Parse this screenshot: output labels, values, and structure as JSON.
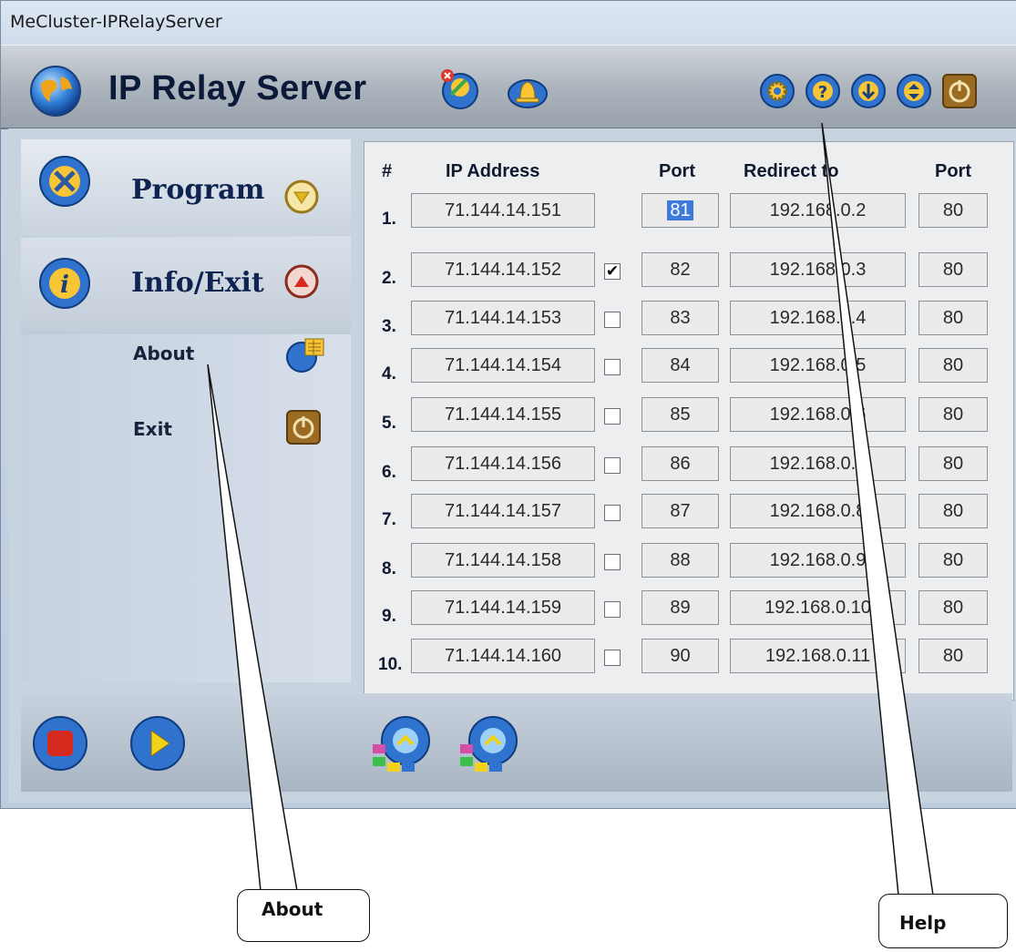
{
  "window": {
    "title": "MeCluster-IPRelayServer"
  },
  "app": {
    "title": "IP Relay Server"
  },
  "toolbar_icons": [
    "connect-icon",
    "bell-icon",
    "settings-gear-icon",
    "help-icon",
    "download-icon",
    "updown-icon",
    "power-icon"
  ],
  "sidebar": {
    "program": {
      "label": "Program",
      "icon": "tools-icon",
      "toggle_icon": "expand-down-icon"
    },
    "info": {
      "label": "Info/Exit",
      "icon": "info-icon",
      "toggle_icon": "collapse-up-icon"
    },
    "items": [
      {
        "label": "About",
        "icon": "about-icon"
      },
      {
        "label": "Exit",
        "icon": "exit-power-icon"
      }
    ]
  },
  "table": {
    "headers": {
      "num": "#",
      "ip": "IP Address",
      "port": "Port",
      "redirect": "Redirect to",
      "port2": "Port"
    },
    "rows": [
      {
        "num": "1.",
        "ip": "71.144.14.151",
        "checked": null,
        "port": "81",
        "redirect": "192.168.0.2",
        "rport": "80"
      },
      {
        "num": "2.",
        "ip": "71.144.14.152",
        "checked": true,
        "port": "82",
        "redirect": "192.168.0.3",
        "rport": "80"
      },
      {
        "num": "3.",
        "ip": "71.144.14.153",
        "checked": false,
        "port": "83",
        "redirect": "192.168.0.4",
        "rport": "80"
      },
      {
        "num": "4.",
        "ip": "71.144.14.154",
        "checked": false,
        "port": "84",
        "redirect": "192.168.0.5",
        "rport": "80"
      },
      {
        "num": "5.",
        "ip": "71.144.14.155",
        "checked": false,
        "port": "85",
        "redirect": "192.168.0.6",
        "rport": "80"
      },
      {
        "num": "6.",
        "ip": "71.144.14.156",
        "checked": false,
        "port": "86",
        "redirect": "192.168.0.7",
        "rport": "80"
      },
      {
        "num": "7.",
        "ip": "71.144.14.157",
        "checked": false,
        "port": "87",
        "redirect": "192.168.0.8",
        "rport": "80"
      },
      {
        "num": "8.",
        "ip": "71.144.14.158",
        "checked": false,
        "port": "88",
        "redirect": "192.168.0.9",
        "rport": "80"
      },
      {
        "num": "9.",
        "ip": "71.144.14.159",
        "checked": false,
        "port": "89",
        "redirect": "192.168.0.10",
        "rport": "80"
      },
      {
        "num": "10.",
        "ip": "71.144.14.160",
        "checked": false,
        "port": "90",
        "redirect": "192.168.0.11",
        "rport": "80"
      }
    ]
  },
  "bottom": {
    "icons": [
      "stop-icon",
      "play-icon",
      "network-up-icon",
      "network-up-icon"
    ]
  },
  "callouts": {
    "about": "About",
    "help": "Help"
  },
  "colors": {
    "accent_blue": "#2f6fd6",
    "stop_red": "#d62a1e",
    "play_yellow": "#f2d21a",
    "power_brown": "#9a6b22"
  }
}
